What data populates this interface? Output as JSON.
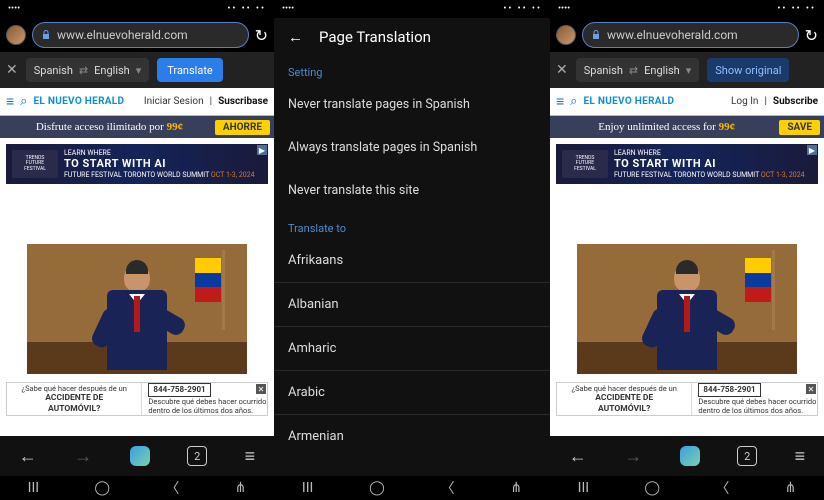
{
  "statusbar": {
    "indicators": "•• •• ••"
  },
  "addr": {
    "url": "www.elnuevoherald.com"
  },
  "translate_bar": {
    "from_lang": "Spanish",
    "to_lang": "English",
    "translate_btn": "Translate",
    "show_original_btn": "Show original"
  },
  "site": {
    "brand": "EL NUEVO HERALD",
    "login_es": "Iniciar Sesion",
    "subscribe_es": "Suscribase",
    "login_en": "Log In",
    "subscribe_en": "Subscribe"
  },
  "promo": {
    "text_es": "Disfrute acceso ilimitado por",
    "text_en": "Enjoy unlimited access for",
    "price": "99¢",
    "save_es": "AHORRE",
    "save_en": "SAVE"
  },
  "ad_top": {
    "fest_line1": "TRENDS",
    "fest_line2": "FUTURE",
    "fest_line3": "FESTIVAL",
    "line1": "LEARN WHERE",
    "line2": "TO START WITH AI",
    "line3": "FUTURE FESTIVAL TORONTO WORLD SUMMIT",
    "date": "OCT 1-3, 2024"
  },
  "ad_bottom": {
    "q_es": "¿Sabe qué hacer después de un",
    "bold_es": "ACCIDENTE DE",
    "bold2_es": "AUTOMÓVIL?",
    "phone": "844-758-2901",
    "sub": "Descubre qué debes hacer ocurrido dentro de los últimos dos años."
  },
  "nav": {
    "tab_count": "2"
  },
  "settings": {
    "title": "Page Translation",
    "header1": "Setting",
    "items": [
      "Never translate pages in Spanish",
      "Always translate pages in Spanish",
      "Never translate this site"
    ],
    "header2": "Translate to",
    "languages": [
      "Afrikaans",
      "Albanian",
      "Amharic",
      "Arabic",
      "Armenian"
    ]
  }
}
